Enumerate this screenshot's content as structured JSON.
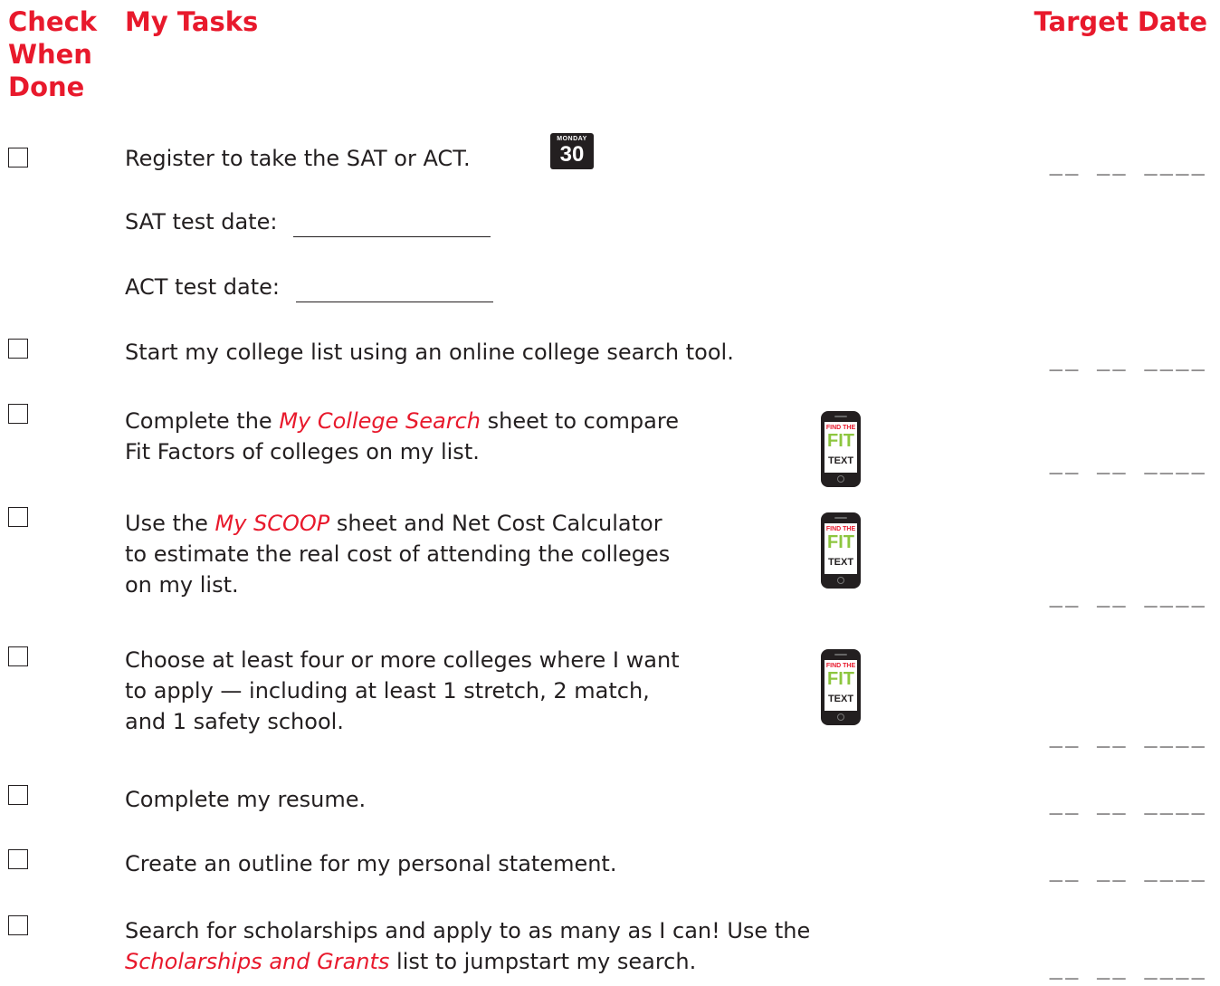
{
  "header": {
    "check_when_done": "Check When Done",
    "my_tasks": "My Tasks",
    "target_date": "Target Date"
  },
  "date_blank": "__ __ ____",
  "calendar_icon": {
    "month": "MONDAY",
    "day": "30",
    "icon": "calendar-icon"
  },
  "phone_icon": {
    "line1": "FIND THE",
    "line2": "FIT",
    "line3": "TEXT",
    "icon": "phone-icon"
  },
  "tasks": {
    "t1": {
      "text": "Register to take the SAT or ACT."
    },
    "sat": {
      "label": "SAT test date:"
    },
    "act": {
      "label": "ACT test date:"
    },
    "t2": {
      "text": "Start my college list using an online college search tool."
    },
    "t3": {
      "pre": "Complete the ",
      "emph": "My College Search",
      "post1": " sheet to compare",
      "line2": "Fit Factors of colleges on my list."
    },
    "t4": {
      "pre": "Use the ",
      "emph": "My SCOOP",
      "post1": " sheet and  Net Cost Calculator",
      "line2": "to estimate the real cost of attending the colleges",
      "line3": "on my list."
    },
    "t5": {
      "line1": "Choose at least four or more colleges where I want",
      "line2": "to apply — including at least 1 stretch, 2 match,",
      "line3": "and 1 safety school."
    },
    "t6": {
      "text": "Complete my resume."
    },
    "t7": {
      "text": "Create an outline for my personal statement."
    },
    "t8": {
      "line1": "Search for scholarships and apply to as many as I can! Use the",
      "emph": "Scholarships and Grants",
      "post2": " list to jumpstart my search."
    }
  },
  "colors": {
    "accent": "#e8192c",
    "text": "#231f20",
    "phone_green": "#8dc63f"
  }
}
